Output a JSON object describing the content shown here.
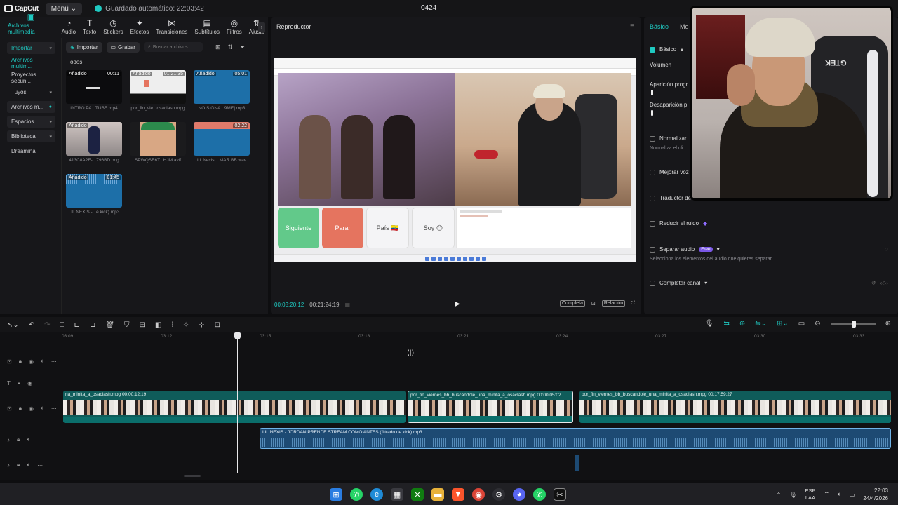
{
  "app": {
    "logo": "CapCut",
    "menu_label": "Menú",
    "autosave": "Guardado automático: 22:03:42",
    "project_title": "0424"
  },
  "tool_tabs": [
    {
      "label": "Archivos multimedia",
      "icon": "media-icon"
    },
    {
      "label": "Audio",
      "icon": "audio-icon"
    },
    {
      "label": "Texto",
      "icon": "text-icon"
    },
    {
      "label": "Stickers",
      "icon": "sticker-icon"
    },
    {
      "label": "Efectos",
      "icon": "effects-icon"
    },
    {
      "label": "Transiciones",
      "icon": "transitions-icon"
    },
    {
      "label": "Subtítulos",
      "icon": "subtitles-icon"
    },
    {
      "label": "Filtros",
      "icon": "filters-icon"
    },
    {
      "label": "Ajuste",
      "icon": "adjust-icon"
    }
  ],
  "sidebar": {
    "items": [
      {
        "label": "Importar"
      },
      {
        "label": "Archivos multim..."
      },
      {
        "label": "Proyectos secun..."
      },
      {
        "label": "Tuyos"
      },
      {
        "label": "Archivos m..."
      },
      {
        "label": "Espacios"
      },
      {
        "label": "Biblioteca"
      },
      {
        "label": "Dreamina"
      }
    ]
  },
  "media": {
    "import_label": "Importar",
    "record_label": "Grabar",
    "search_placeholder": "Buscar archivos ...",
    "section_label": "Todos",
    "added_label": "Añadido",
    "items": [
      {
        "name": "INTRO PA...TUBE.mp4",
        "duration": "00:11"
      },
      {
        "name": "por_fin_vie...osaclash.mpg",
        "duration": "01:21:35"
      },
      {
        "name": "NO SIGNA...9ME].mp3",
        "duration": "05:01"
      },
      {
        "name": "413C8A2E-...796BD.png",
        "duration": ""
      },
      {
        "name": "SPWQSE6T...HJM.avif",
        "duration": ""
      },
      {
        "name": "Lil Nexis ...MAR BB.wav",
        "duration": "02:22"
      },
      {
        "name": "LIL NEXIS -...e kick).mp3",
        "duration": "01:45"
      }
    ]
  },
  "player": {
    "title": "Reproductor",
    "current_time": "00:03:20:12",
    "total_time": "00:21:24:19",
    "quality_label": "Completa",
    "ratio_label": "Relación",
    "buttons": [
      "Siguiente",
      "Parar",
      "País 🇪🇨",
      "Soy 😊"
    ]
  },
  "properties": {
    "tabs": [
      "Básico",
      "Mo"
    ],
    "basic_label": "Básico",
    "volume_label": "Volumen",
    "fade_in_label": "Aparición progr",
    "fade_out_label": "Desaparición p",
    "normalize_label": "Normalizar",
    "normalize_desc": "Normaliza el cli",
    "enhance_voice_label": "Mejorar voz",
    "translator_label": "Traductor de",
    "reduce_noise_label": "Reducir el ruido",
    "separate_audio_label": "Separar audio",
    "free_badge": "Free",
    "separate_audio_desc": "Selecciona los elementos del audio que quieres separar.",
    "complete_channel_label": "Completar canal"
  },
  "webcam": {
    "chair_text": "GTEK"
  },
  "timeline": {
    "ticks": [
      "03:09",
      "03:12",
      "03:15",
      "03:18",
      "03:21",
      "03:24",
      "03:27",
      "03:30",
      "03:33"
    ],
    "video_clips": [
      {
        "label": "na_minita_a_osaclash.mpg  00:00:12:19"
      },
      {
        "label": "por_fin_viernes_bb_buscandole_una_minita_a_osaclash.mpg  00:00:05:02"
      },
      {
        "label": "por_fin_viernes_bb_buscandole_una_minita_a_osaclash.mpg  00:17:59:27"
      }
    ],
    "audio_clip": {
      "label": "LIL NEXIS - JORDAN PRENDE STREAM COMO ANTES (filtrado de kick).mp3"
    }
  },
  "taskbar": {
    "lang_top": "ESP",
    "lang_bottom": "LAA",
    "time": "22:03",
    "date": "24/4/2026"
  },
  "colors": {
    "accent": "#1fc9c1",
    "video_clip": "#0f5c5a",
    "audio_clip": "#1d4a73",
    "free_badge": "#7a57e6"
  }
}
